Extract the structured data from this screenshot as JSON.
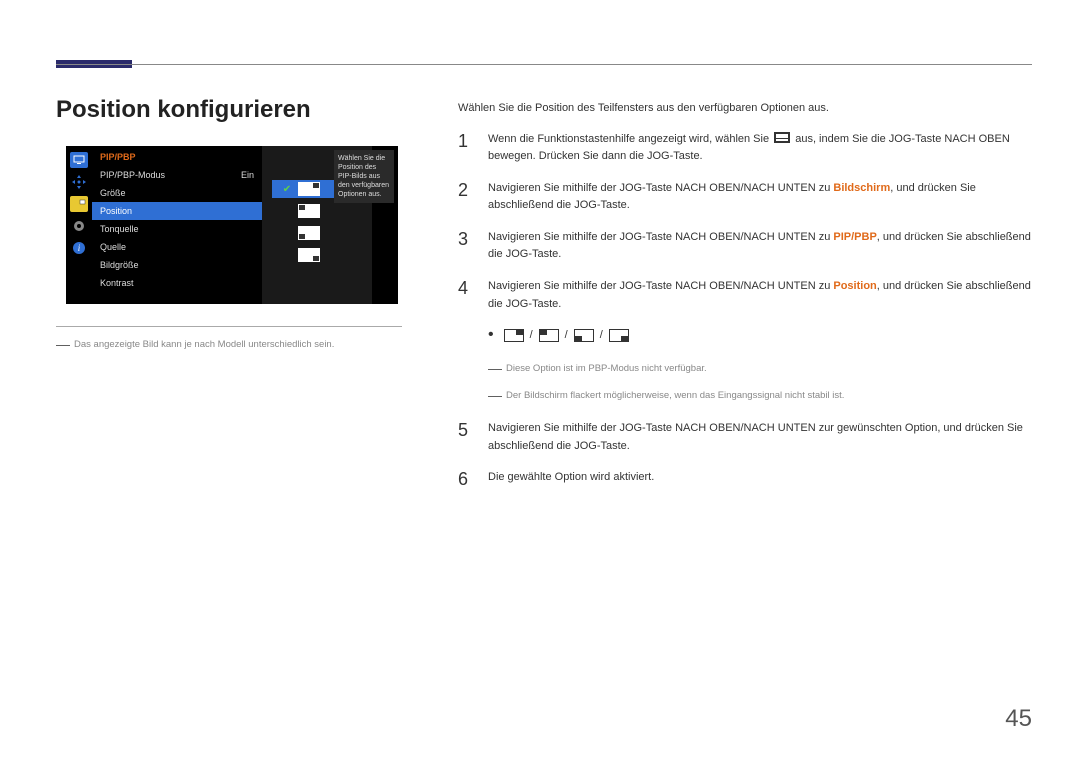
{
  "page_title": "Position konfigurieren",
  "page_number": "45",
  "osd": {
    "header": "PIP/PBP",
    "rows": [
      {
        "label": "PIP/PBP-Modus",
        "value": "Ein"
      },
      {
        "label": "Größe",
        "value": ""
      },
      {
        "label": "Position",
        "value": "",
        "selected": true
      },
      {
        "label": "Tonquelle",
        "value": ""
      },
      {
        "label": "Quelle",
        "value": ""
      },
      {
        "label": "Bildgröße",
        "value": ""
      },
      {
        "label": "Kontrast",
        "value": ""
      }
    ],
    "help": "Wählen Sie die Position des PIP-Bilds aus den verfügbaren Optionen aus."
  },
  "caption": "Das angezeigte Bild kann je nach Modell unterschiedlich sein.",
  "intro": "Wählen Sie die Position des Teilfensters aus den verfügbaren Optionen aus.",
  "steps": {
    "s1a": "Wenn die Funktionstastenhilfe angezeigt wird, wählen Sie ",
    "s1b": " aus, indem Sie die JOG-Taste NACH OBEN bewegen. Drücken Sie dann die JOG-Taste.",
    "s2a": "Navigieren Sie mithilfe der JOG-Taste NACH OBEN/NACH UNTEN zu ",
    "s2hl": "Bildschirm",
    "s2b": ", und drücken Sie abschließend die JOG-Taste.",
    "s3a": "Navigieren Sie mithilfe der JOG-Taste NACH OBEN/NACH UNTEN zu ",
    "s3hl": "PIP/PBP",
    "s3b": ", und drücken Sie abschließend die JOG-Taste.",
    "s4a": "Navigieren Sie mithilfe der JOG-Taste NACH OBEN/NACH UNTEN zu ",
    "s4hl": "Position",
    "s4b": ", und drücken Sie abschließend die JOG-Taste.",
    "s5": "Navigieren Sie mithilfe der JOG-Taste NACH OBEN/NACH UNTEN zur gewünschten Option, und drücken Sie abschließend die JOG-Taste.",
    "s6": "Die gewählte Option wird aktiviert."
  },
  "notes": {
    "n1": "Diese Option ist im PBP-Modus nicht verfügbar.",
    "n2": "Der Bildschirm flackert möglicherweise, wenn das Eingangssignal nicht stabil ist."
  },
  "step_numbers": {
    "n1": "1",
    "n2": "2",
    "n3": "3",
    "n4": "4",
    "n5": "5",
    "n6": "6"
  }
}
